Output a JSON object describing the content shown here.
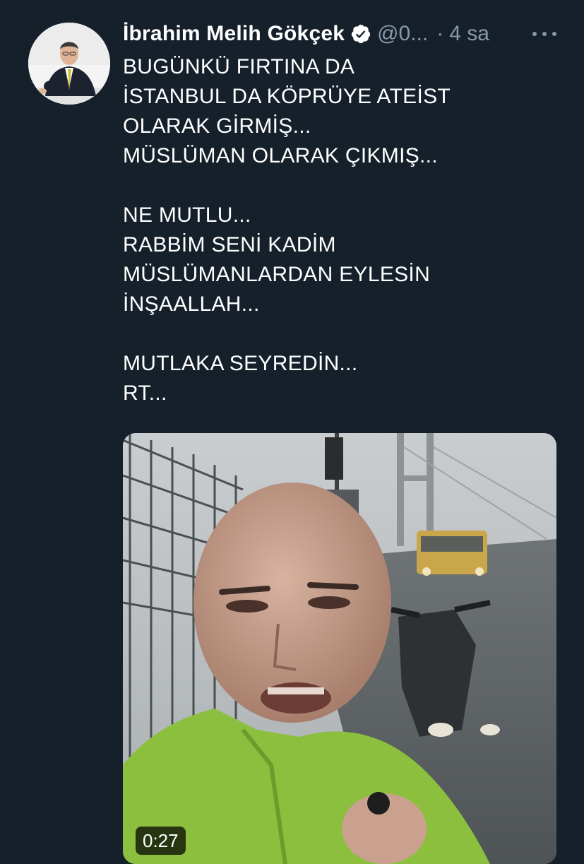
{
  "tweet": {
    "author": {
      "display_name": "İbrahim Melih Gökçek",
      "handle": "@0...",
      "verified": true,
      "avatar_icon": "avatar-portrait"
    },
    "separator": "·",
    "time": "4 sa",
    "more_icon": "more-horizontal-icon",
    "text_lines": [
      "BUGÜNKÜ FIRTINA DA",
      "İSTANBUL DA KÖPRÜYE ATEİST",
      "OLARAK GİRMİŞ...",
      "MÜSLÜMAN OLARAK ÇIKMIŞ...",
      "",
      "NE MUTLU...",
      "RABBİM SENİ KADİM",
      "MÜSLÜMANLARDAN EYLESİN",
      "İNŞAALLAH...",
      "",
      "MUTLAKA SEYREDİN...",
      "RT..."
    ],
    "media": {
      "type": "video",
      "duration": "0:27"
    }
  },
  "colors": {
    "background": "#15202b",
    "text": "#ffffff",
    "secondary_text": "#8899a6",
    "verified_badge": "#ffffff"
  }
}
